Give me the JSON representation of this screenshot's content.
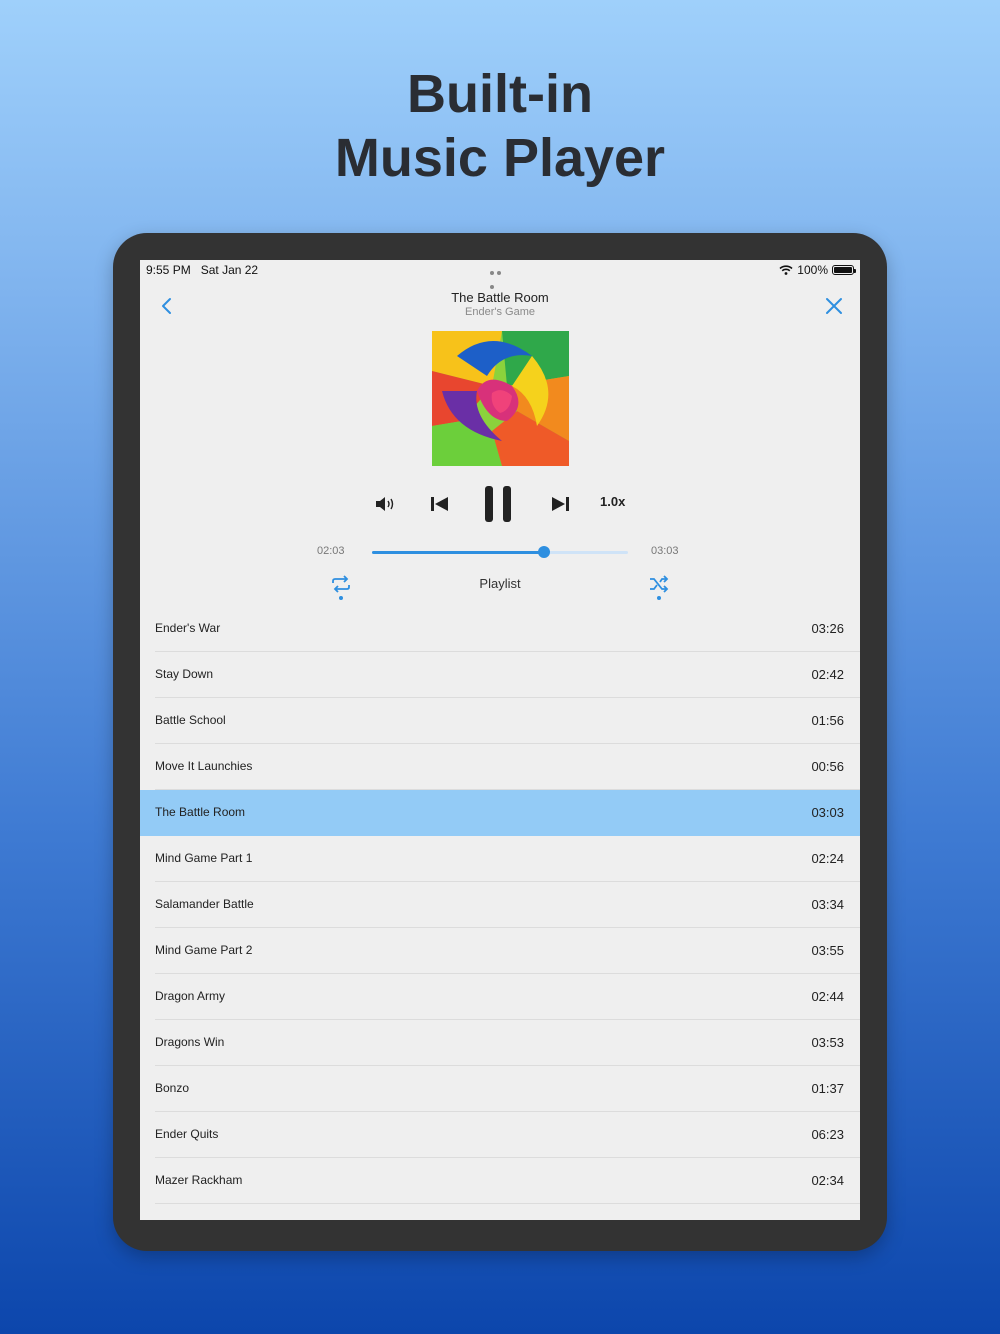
{
  "headline": {
    "line1": "Built-in",
    "line2": "Music Player"
  },
  "status_bar": {
    "time": "9:55 PM",
    "date": "Sat Jan 22",
    "battery": "100%"
  },
  "player": {
    "title": "The Battle Room",
    "album": "Ender's Game",
    "speed": "1.0x",
    "elapsed": "02:03",
    "total": "03:03",
    "progress": 0.67,
    "playlist_label": "Playlist"
  },
  "colors": {
    "accent": "#2e8fe0",
    "active_row": "#93cbf6"
  },
  "icons": [
    "back-chevron-icon",
    "close-icon",
    "volume-icon",
    "previous-track-icon",
    "pause-icon",
    "next-track-icon",
    "repeat-icon",
    "shuffle-icon",
    "wifi-icon",
    "battery-icon"
  ],
  "playlist": [
    {
      "name": "Ender's War",
      "duration": "03:26"
    },
    {
      "name": "Stay Down",
      "duration": "02:42"
    },
    {
      "name": "Battle School",
      "duration": "01:56"
    },
    {
      "name": "Move It Launchies",
      "duration": "00:56"
    },
    {
      "name": "The Battle Room",
      "duration": "03:03",
      "active": true
    },
    {
      "name": "Mind Game Part 1",
      "duration": "02:24"
    },
    {
      "name": "Salamander Battle",
      "duration": "03:34"
    },
    {
      "name": "Mind Game Part 2",
      "duration": "03:55"
    },
    {
      "name": "Dragon Army",
      "duration": "02:44"
    },
    {
      "name": "Dragons Win",
      "duration": "03:53"
    },
    {
      "name": "Bonzo",
      "duration": "01:37"
    },
    {
      "name": "Ender Quits",
      "duration": "06:23"
    },
    {
      "name": "Mazer Rackham",
      "duration": "02:34"
    }
  ]
}
